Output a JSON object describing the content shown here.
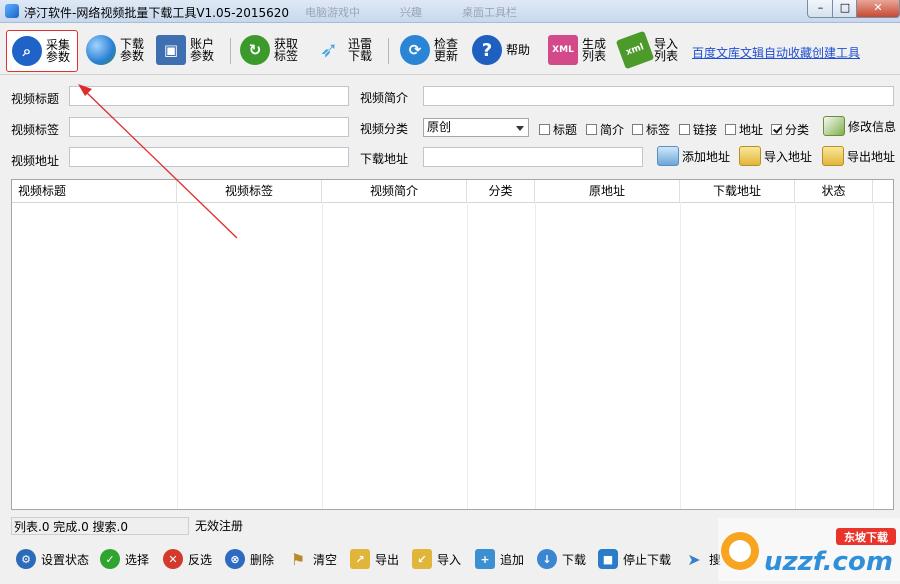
{
  "window": {
    "title": "渟汀软件-网络视频批量下载工具V1.05-2015620",
    "ghost_titles": [
      "电脑游戏中",
      "兴趣",
      "桌面工具栏"
    ],
    "controls": {
      "min": "–",
      "max": "□",
      "close": "✕"
    }
  },
  "toolbar": {
    "items": [
      {
        "label": "采集参数",
        "icon": "search-icon",
        "color": "#1f62c8"
      },
      {
        "label": "下载参数",
        "icon": "globe-icon",
        "color": "#2a7fd4"
      },
      {
        "label": "账户参数",
        "icon": "floppy-icon",
        "color": "#3e6fb0"
      },
      {
        "label": "获取标签",
        "icon": "refresh-icon",
        "color": "#3c9a2d"
      },
      {
        "label": "迅雷下载",
        "icon": "thunder-icon",
        "color": "#4aa6e0"
      },
      {
        "label": "检查更新",
        "icon": "update-icon",
        "color": "#2a86d4"
      },
      {
        "label": "帮助",
        "icon": "help-icon",
        "color": "#1f5fbf"
      },
      {
        "label": "生成列表",
        "icon": "xml-icon",
        "color": "#d24a8a"
      },
      {
        "label": "导入列表",
        "icon": "import-list-icon",
        "color": "#4c9a2a"
      }
    ],
    "link": "百度文库文辑自动收藏创建工具"
  },
  "form": {
    "title_label": "视频标题",
    "intro_label": "视频简介",
    "tags_label": "视频标签",
    "category_label": "视频分类",
    "category_value": "原创",
    "url_label": "视频地址",
    "download_label": "下载地址",
    "checkboxes": [
      {
        "label": "标题",
        "checked": false
      },
      {
        "label": "简介",
        "checked": false
      },
      {
        "label": "标签",
        "checked": false
      },
      {
        "label": "链接",
        "checked": false
      },
      {
        "label": "地址",
        "checked": false
      },
      {
        "label": "分类",
        "checked": true
      }
    ],
    "edit_info": "修改信息",
    "add_address": "添加地址",
    "import_address": "导入地址",
    "export_address": "导出地址"
  },
  "table": {
    "columns": [
      "视频标题",
      "视频标签",
      "视频简介",
      "分类",
      "原地址",
      "下载地址",
      "状态"
    ]
  },
  "status": {
    "counts": "列表.0 完成.0 搜索.0",
    "registration": "无效注册"
  },
  "bottom": {
    "buttons": [
      {
        "label": "设置状态",
        "icon": "settings-icon",
        "color": "#2c6bb8"
      },
      {
        "label": "选择",
        "icon": "check-icon",
        "color": "#2fa52f"
      },
      {
        "label": "反选",
        "icon": "invert-icon",
        "color": "#d33a2c"
      },
      {
        "label": "删除",
        "icon": "delete-icon",
        "color": "#2e6ac2"
      },
      {
        "label": "清空",
        "icon": "broom-icon",
        "color": "#b98a2a"
      },
      {
        "label": "导出",
        "icon": "export-icon",
        "color": "#e0b53a"
      },
      {
        "label": "导入",
        "icon": "import-icon",
        "color": "#e0b53a"
      },
      {
        "label": "追加",
        "icon": "append-icon",
        "color": "#3c8fd0"
      },
      {
        "label": "下载",
        "icon": "download-icon",
        "color": "#3a86d0"
      },
      {
        "label": "停止下载",
        "icon": "stop-download-icon",
        "color": "#2a7cc8"
      },
      {
        "label": "搜",
        "icon": "search-send-icon",
        "color": "#3a7fc8"
      }
    ]
  },
  "watermark": {
    "text": "uzzf.com",
    "sub": "东坡下载"
  }
}
